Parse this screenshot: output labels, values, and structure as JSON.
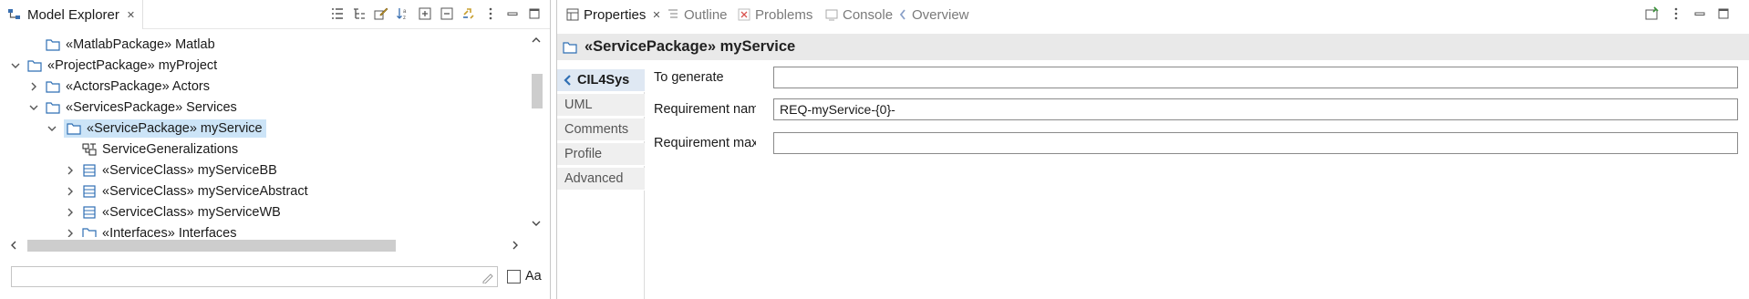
{
  "explorer": {
    "tab_label": "Model Explorer",
    "tree": [
      {
        "label": "«MatlabPackage» Matlab",
        "expander": "none",
        "icon": "folder-icon"
      },
      {
        "label": "«ProjectPackage» myProject",
        "expander": "expanded",
        "icon": "folder-icon"
      },
      {
        "label": "«ActorsPackage» Actors",
        "expander": "collapsed",
        "icon": "folder-icon"
      },
      {
        "label": "«ServicesPackage» Services",
        "expander": "expanded",
        "icon": "folder-icon"
      },
      {
        "label": "«ServicePackage» myService",
        "expander": "expanded",
        "icon": "folder-icon",
        "selected": true
      },
      {
        "label": "ServiceGeneralizations",
        "expander": "none",
        "icon": "generalization-icon"
      },
      {
        "label": "«ServiceClass» myServiceBB",
        "expander": "collapsed",
        "icon": "class-icon"
      },
      {
        "label": "«ServiceClass» myServiceAbstract",
        "expander": "collapsed",
        "icon": "class-icon"
      },
      {
        "label": "«ServiceClass» myServiceWB",
        "expander": "collapsed",
        "icon": "class-icon"
      },
      {
        "label": "«Interfaces» Interfaces",
        "expander": "collapsed",
        "icon": "folder-icon"
      }
    ],
    "filter": {
      "value": "",
      "placeholder": ""
    },
    "case_label": "Aa",
    "case_checked": false
  },
  "properties": {
    "tabs": [
      {
        "label": "Properties",
        "active": true
      },
      {
        "label": "Outline",
        "active": false
      },
      {
        "label": "Problems",
        "active": false
      },
      {
        "label": "Console",
        "active": false
      },
      {
        "label": "Overview",
        "active": false
      }
    ],
    "title": "«ServicePackage» myService",
    "categories": [
      "CIL4Sys",
      "UML",
      "Comments",
      "Profile",
      "Advanced"
    ],
    "active_category": "CIL4Sys",
    "fields": [
      {
        "label": "To generate",
        "value": ""
      },
      {
        "label": "Requirement name",
        "value": "REQ-myService-{0}-"
      },
      {
        "label": "Requirement max",
        "value": ""
      }
    ]
  },
  "colors": {
    "selection": "#cce4f7",
    "title_bar": "#e9e9e9",
    "folder": "#2f6fb4"
  }
}
